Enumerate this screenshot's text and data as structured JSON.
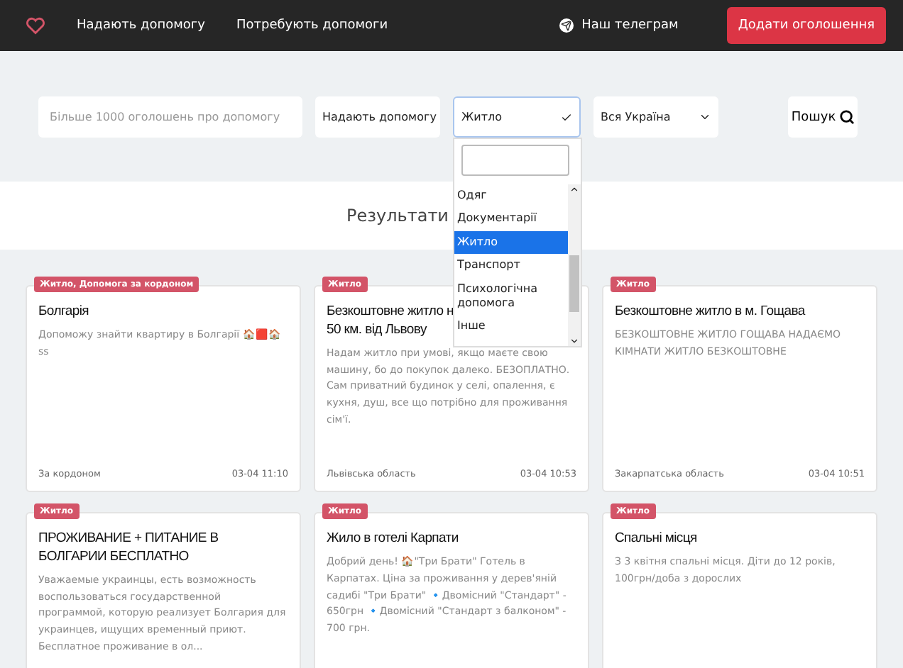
{
  "navbar": {
    "links": [
      "Надають допомогу",
      "Потребують допомоги"
    ],
    "telegram": "Наш телеграм",
    "add_button": "Додати оголошення"
  },
  "filters": {
    "search": {
      "placeholder": "Більше 1000 оголошень про допомогу"
    },
    "type_select": "Надають допомогу",
    "category_select": "Житло",
    "region_select": "Вся Україна",
    "search_button": "Пошук"
  },
  "category_dropdown": {
    "options": [
      {
        "label": "Одяг",
        "selected": false
      },
      {
        "label": "Документарії",
        "selected": false
      },
      {
        "label": "Житло",
        "selected": true
      },
      {
        "label": "Транспорт",
        "selected": false
      },
      {
        "label": "Психологічна допомога",
        "selected": false
      },
      {
        "label": "Інше",
        "selected": false
      }
    ]
  },
  "results_heading": "Результати",
  "cards": [
    {
      "tag": "Житло, Допомога за кордоном",
      "title": "Болгарія",
      "text": "Допоможу знайти квартиру в Болгарії 🏠🟥🏠ss",
      "region": "За кордоном",
      "date": "03-04 11:10"
    },
    {
      "tag": "Житло",
      "title": "Безкоштовне житло н\n50 км. від Львову",
      "text": "Надам житло при умові, якщо маєте свою машину, бо до покупок далеко. БЕЗОПЛАТНО. Сам приватний будинок у селі, опалення, є кухня, душ, все що потрібно для проживання сім'ї.",
      "region": "Львівська область",
      "date": "03-04 10:53"
    },
    {
      "tag": "Житло",
      "title": "Безкоштовне житло в м. Гощава",
      "text": "БЕЗКОШТОВНЕ ЖИТЛО ГОЩАВА НАДАЄМО КІМНАТИ ЖИТЛО БЕЗКОШТОВНЕ",
      "region": "Закарпатська область",
      "date": "03-04 10:51"
    },
    {
      "tag": "Житло",
      "title": "ПРОЖИВАНИЕ + ПИТАНИЕ В БОЛГАРИИ БЕСПЛАТНО",
      "text": "Уважаемые украинцы, есть возможность воспользоваться государственной программой, которую реализует Болгария для украинцев, ищущих временный приют. Бесплатное проживание в ол..."
    },
    {
      "tag": "Житло",
      "title": "Жило в готелі Карпати",
      "text": "Добрий день! 🏠\"Три Брати\" Готель в Карпатах. Ціна за проживання у дерев'яній садибі \"Три Брати\" 🔹Двомісний \"Стандарт\" - 650грн 🔹Двомісний \"Стандарт з балконом\" - 700 грн."
    },
    {
      "tag": "Житло",
      "title": "Спальні місця",
      "text": "З 3 квітня спальні місця. Діти до 12 років, 100грн/доба з дорослих"
    }
  ]
}
